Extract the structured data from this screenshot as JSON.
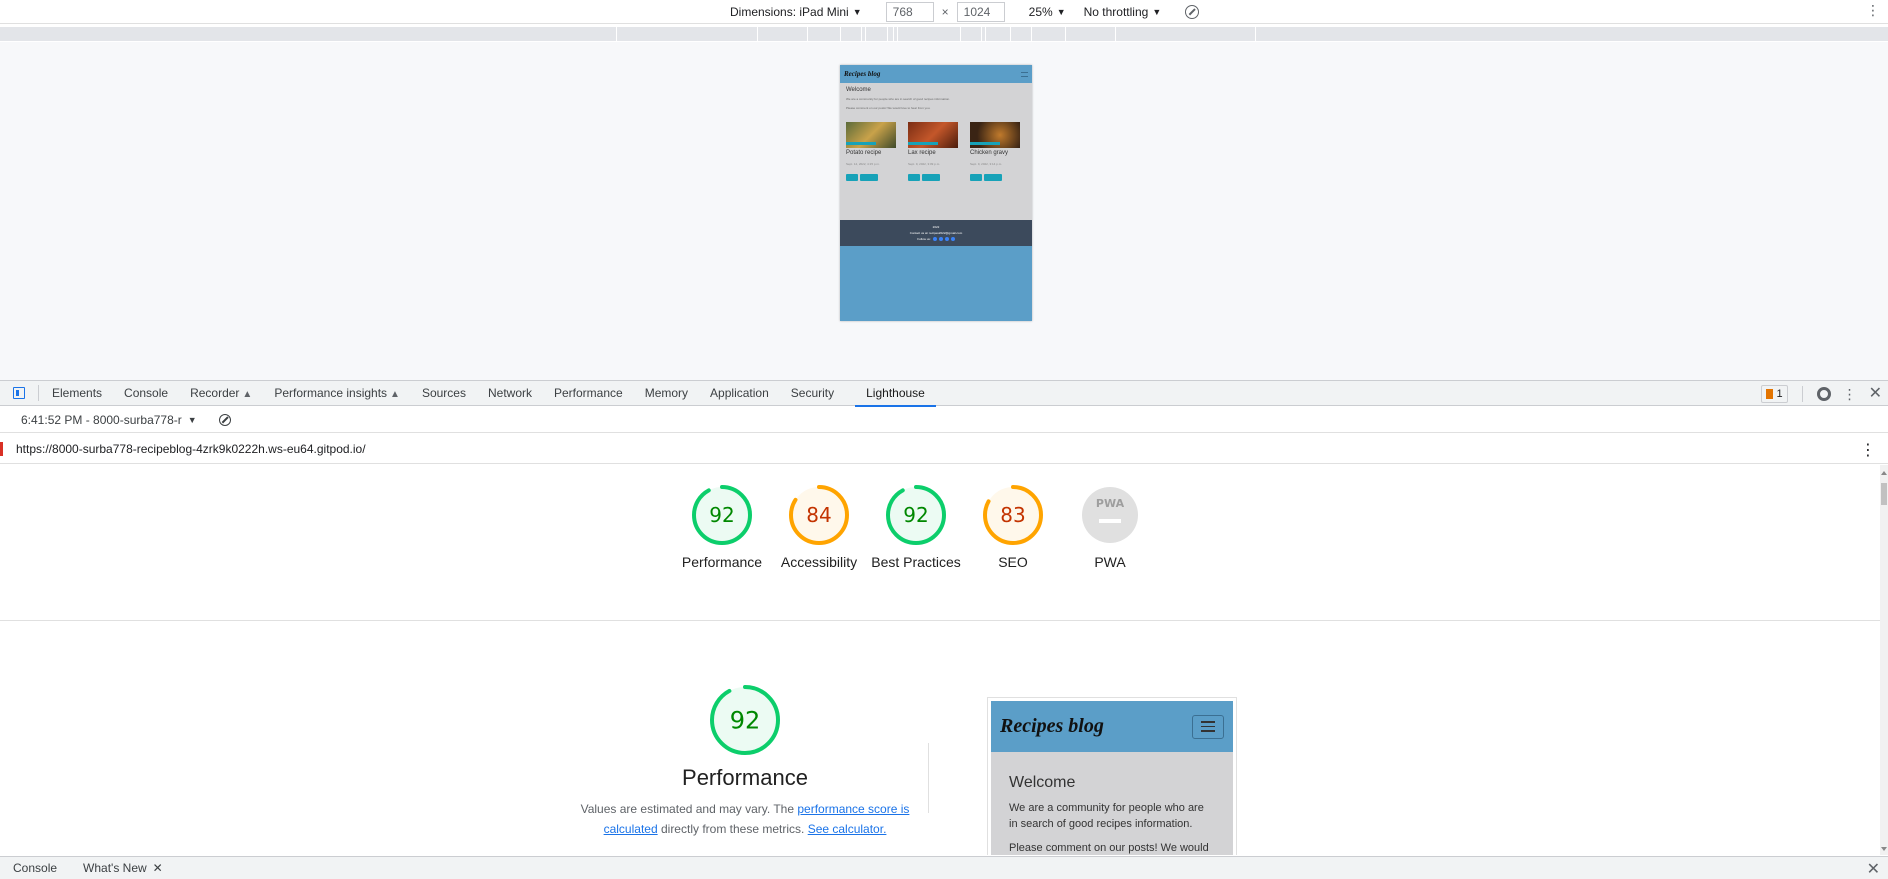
{
  "device_toolbar": {
    "dimensions_label": "Dimensions: iPad Mini",
    "width_value": "768",
    "height_value": "1024",
    "times": "×",
    "zoom": "25%",
    "throttling": "No throttling"
  },
  "mini_site": {
    "brand": "Recipes blog",
    "welcome": "Welcome",
    "line1": "We are a community for people who are in search of good recipes information.",
    "line2": "Please comment on our posts! We would love to hear from you.",
    "cards": [
      {
        "title": "Potato recipe",
        "date": "Sept. 14, 2022, 4:15 p.m."
      },
      {
        "title": "Lax recipe",
        "date": "Sept. 9, 2022, 3:09 p.m."
      },
      {
        "title": "Chicken gravy",
        "date": "Sept. 9, 2022, 3:14 p.m."
      }
    ],
    "footer_year": "2022",
    "footer_contact": "Contact us at: recipes2022@gmail.com",
    "footer_follow": "Follow us:"
  },
  "devtools": {
    "tabs": [
      {
        "label": "Elements"
      },
      {
        "label": "Console"
      },
      {
        "label": "Recorder"
      },
      {
        "label": "Performance insights"
      },
      {
        "label": "Sources"
      },
      {
        "label": "Network"
      },
      {
        "label": "Performance"
      },
      {
        "label": "Memory"
      },
      {
        "label": "Application"
      },
      {
        "label": "Security"
      },
      {
        "label": "Lighthouse"
      }
    ],
    "issues_count": "1"
  },
  "lighthouse": {
    "report_selector": "6:41:52 PM - 8000-surba778-r",
    "url": "https://8000-surba778-recipeblog-4zrk9k0222h.ws-eu64.gitpod.io/",
    "scores": [
      {
        "label": "Performance",
        "value": "92",
        "score": 92,
        "color": "#0cce6b",
        "text_color": "#008800"
      },
      {
        "label": "Accessibility",
        "value": "84",
        "score": 84,
        "color": "#ffa400",
        "text_color": "#c33300"
      },
      {
        "label": "Best Practices",
        "value": "92",
        "score": 92,
        "color": "#0cce6b",
        "text_color": "#008800"
      },
      {
        "label": "SEO",
        "value": "83",
        "score": 83,
        "color": "#ffa400",
        "text_color": "#c33300"
      },
      {
        "label": "PWA",
        "value": "PWA",
        "score": 0,
        "color": "#cccccc",
        "text_color": "#9e9e9e"
      }
    ],
    "performance": {
      "score": "92",
      "title": "Performance",
      "desc_1": "Values are estimated and may vary. The ",
      "link_1": "performance score is calculated",
      "desc_2": " directly from these metrics. ",
      "link_2": "See calculator."
    },
    "screenshot": {
      "brand": "Recipes blog",
      "welcome": "Welcome",
      "text": "We are a community for people who are in search of good recipes information.",
      "text2": "Please comment on our posts! We would"
    }
  },
  "drawer": {
    "tabs": [
      {
        "label": "Console"
      },
      {
        "label": "What's New"
      }
    ]
  }
}
